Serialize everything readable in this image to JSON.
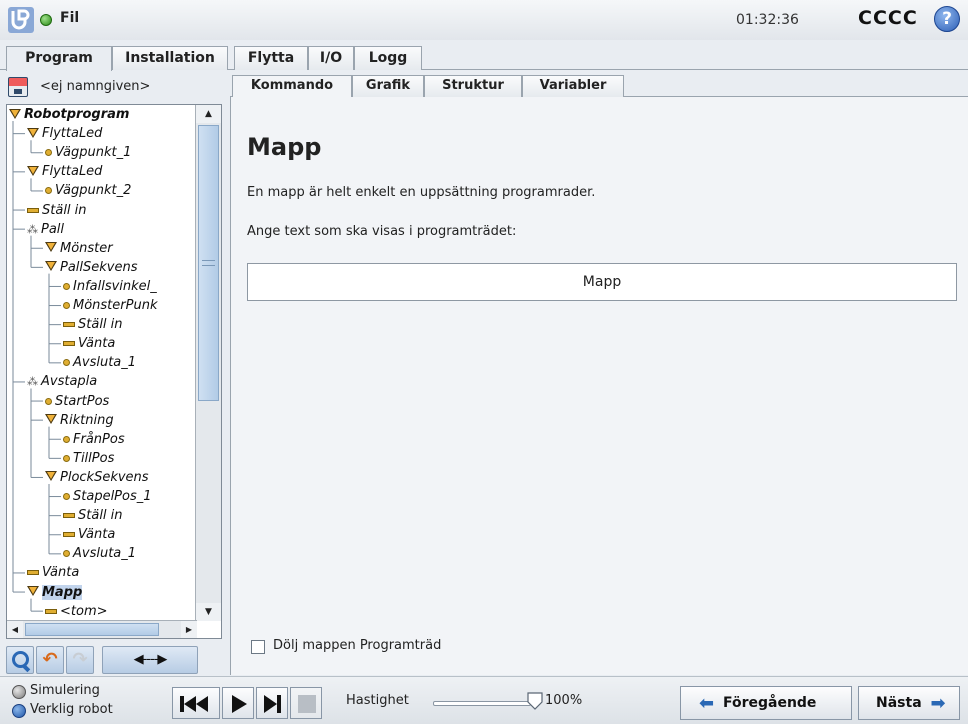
{
  "header": {
    "file_label": "Fil",
    "clock": "01:32:36",
    "robot_name": "CCCC",
    "help_label": "?"
  },
  "main_tabs": [
    {
      "label": "Program",
      "active": true
    },
    {
      "label": "Installation",
      "active": false
    },
    {
      "label": "Flytta",
      "active": false
    },
    {
      "label": "I/O",
      "active": false
    },
    {
      "label": "Logg",
      "active": false
    }
  ],
  "program": {
    "file_name": "<ej namngiven>"
  },
  "tree": {
    "items": [
      {
        "label": "Robotprogram",
        "icon": "triangle-icon",
        "bold": true
      },
      {
        "label": "FlyttaLed",
        "icon": "triangle-icon"
      },
      {
        "label": "Vägpunkt_1",
        "icon": "waypoint-icon"
      },
      {
        "label": "FlyttaLed",
        "icon": "triangle-icon"
      },
      {
        "label": "Vägpunkt_2",
        "icon": "waypoint-icon"
      },
      {
        "label": "Ställ in",
        "icon": "bar-icon"
      },
      {
        "label": "Pall",
        "icon": "pallet-icon"
      },
      {
        "label": "Mönster",
        "icon": "triangle-icon"
      },
      {
        "label": "PallSekvens",
        "icon": "triangle-icon"
      },
      {
        "label": "Infallsvinkel_",
        "icon": "waypoint-icon"
      },
      {
        "label": "MönsterPunk",
        "icon": "waypoint-icon"
      },
      {
        "label": "Ställ in",
        "icon": "bar-icon"
      },
      {
        "label": "Vänta",
        "icon": "bar-icon"
      },
      {
        "label": "Avsluta_1",
        "icon": "waypoint-icon"
      },
      {
        "label": "Avstapla",
        "icon": "pallet-icon"
      },
      {
        "label": "StartPos",
        "icon": "waypoint-icon"
      },
      {
        "label": "Riktning",
        "icon": "triangle-icon"
      },
      {
        "label": "FrånPos",
        "icon": "waypoint-icon"
      },
      {
        "label": "TillPos",
        "icon": "waypoint-icon"
      },
      {
        "label": "PlockSekvens",
        "icon": "triangle-icon"
      },
      {
        "label": "StapelPos_1",
        "icon": "waypoint-icon"
      },
      {
        "label": "Ställ in",
        "icon": "bar-icon"
      },
      {
        "label": "Vänta",
        "icon": "bar-icon"
      },
      {
        "label": "Avsluta_1",
        "icon": "waypoint-icon"
      },
      {
        "label": "Vänta",
        "icon": "bar-icon"
      },
      {
        "label": "Mapp",
        "icon": "triangle-icon",
        "bold": true,
        "selected": true
      },
      {
        "label": "<tom>",
        "icon": "bar-icon"
      }
    ],
    "move_label": "◀----▶"
  },
  "sub_tabs": [
    {
      "label": "Kommando",
      "active": true
    },
    {
      "label": "Grafik",
      "active": false
    },
    {
      "label": "Struktur",
      "active": false
    },
    {
      "label": "Variabler",
      "active": false
    }
  ],
  "command": {
    "title": "Mapp",
    "description": "En mapp är helt enkelt en uppsättning programrader.",
    "prompt": "Ange text som ska visas i programträdet:",
    "folder_name_value": "Mapp",
    "hide_checkbox_label": "Dölj mappen Programträd",
    "hide_checked": false
  },
  "footer": {
    "mode_simulation": "Simulering",
    "mode_real": "Verklig robot",
    "speed_label": "Hastighet",
    "speed_value": "100%",
    "prev_label": "Föregående",
    "next_label": "Nästa"
  },
  "colors": {
    "accent": "#2a68b5",
    "status_green": "#2a8a16",
    "node_yellow": "#e0ae32",
    "selection": "#c2d4ec"
  }
}
